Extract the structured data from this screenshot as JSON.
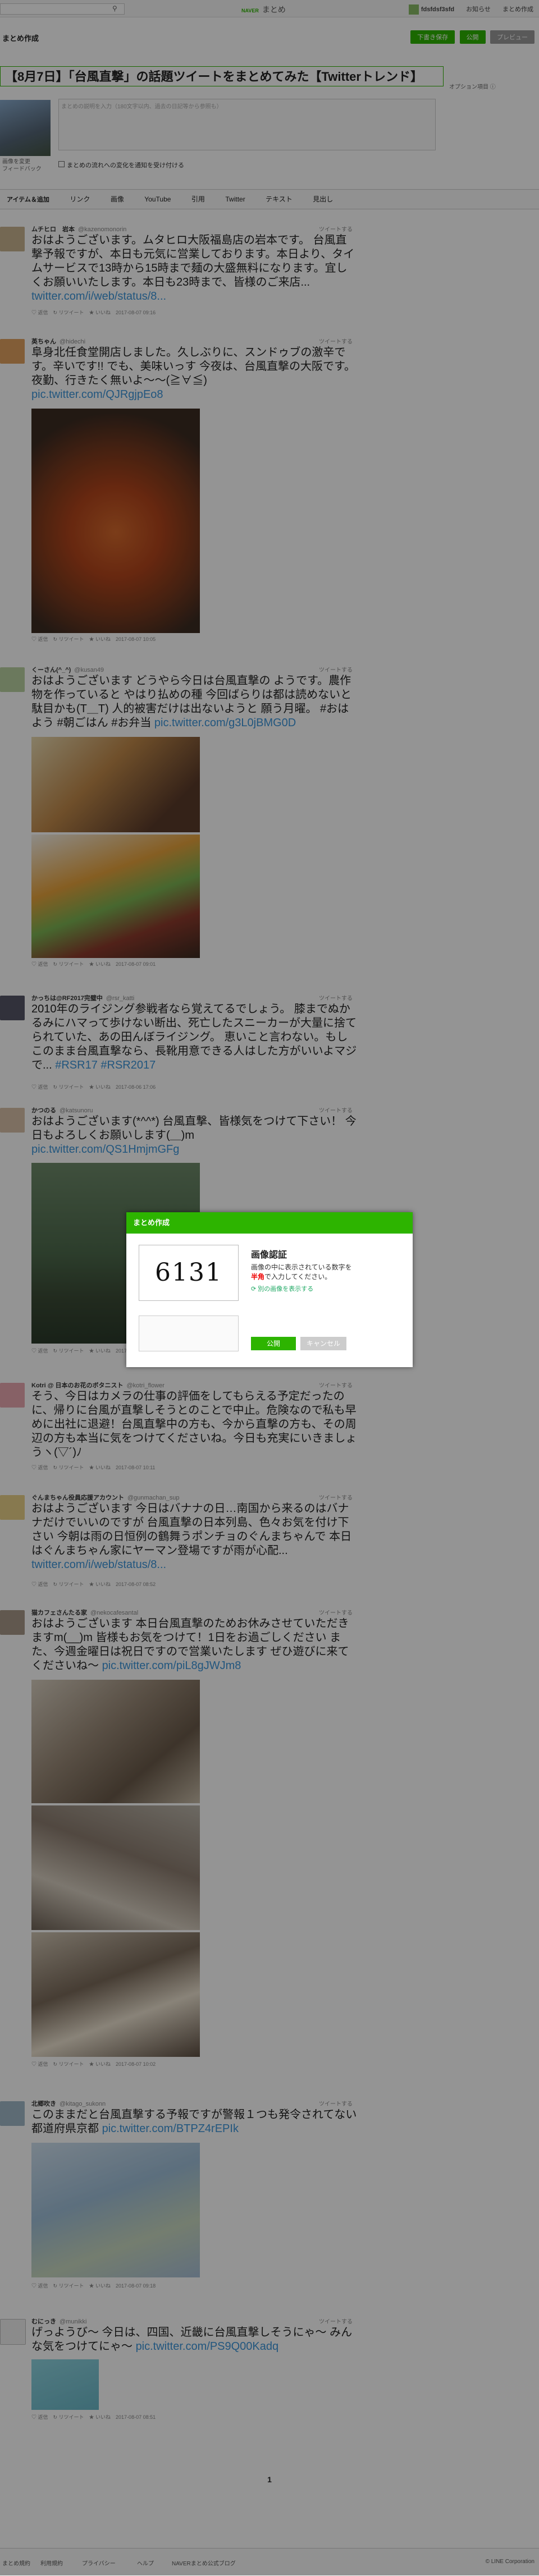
{
  "brand": {
    "naver": "NAVER",
    "name": "まとめ"
  },
  "user": {
    "name": "fdsfdsf3sfd"
  },
  "userlinks": {
    "notice": "お知らせ",
    "my": "まとめ作成"
  },
  "editor": {
    "heading": "まとめ作成",
    "save_draft": "下書き保存",
    "publish": "公開",
    "preview": "プレビュー"
  },
  "title": "【8月7日】「台風直撃」の話題ツイートをまとめてみた【Twitterトレンド】",
  "option_link": "オプション項目 ⓘ",
  "thumb_label": "画像を変更",
  "thumb_link": "フィードバック",
  "description_placeholder": "まとめの説明を入力（180文字以内、過去の日記等から参照も）",
  "notify_label": "まとめの流れへの変化を通知を受け付ける",
  "tabs": [
    "アイテム＆追加",
    "リンク",
    "画像",
    "YouTube",
    "引用",
    "Twitter",
    "テキスト",
    "見出し"
  ],
  "items": [
    {
      "name": "ムチヒロ　岩本",
      "uid": "@kazenomonorin",
      "rt": "ツイートする",
      "text": "おはようございます。ムタヒロ大阪福島店の岩本です。 台風直撃予報ですが、本日も元気に営業しております。本日より、タイムサービスで13時から15時まで麺の大盛無料になります。宜しくお願いいたします。本日も23時まで、皆様のご来店...",
      "link": "twitter.com/i/web/status/8...",
      "meta": "♡ 返信　↻ リツイート　★ いいね　2017-08-07 09:16"
    },
    {
      "name": "英ちゃん",
      "uid": "@hidechi",
      "rt": "ツイートする",
      "text": "阜身北任食堂開店しました。久しぶりに、スンドゥブの激辛です。辛いです!! でも、美味いっす 今夜は、台風直撃の大阪です。 夜勤、行きたく無いよ〜〜(≧∀≦)",
      "link": "pic.twitter.com/QJRgjpEo8",
      "meta": "♡ 返信　↻ リツイート　★ いいね　2017-08-07 10:05"
    },
    {
      "name": "くーさん(^_^)",
      "uid": "@kusan49",
      "rt": "ツイートする",
      "text": "おはようございます どうやら今日は台風直撃の ようです。農作物を作っていると やはり払めの種 今回ばらりは都は読めないと 駄目かも(T＿T) 人的被害だけは出ないようと 願う月曜。 #おはよう #朝ごはん #お弁当",
      "link": "pic.twitter.com/g3L0jBMG0D",
      "meta": "♡ 返信　↻ リツイート　★ いいね　2017-08-07 09:01"
    },
    {
      "name": "かっちは@RF2017完璧中",
      "uid": "@rsr_katti",
      "rt": "ツイートする",
      "text": "2010年のライジング参戦者なら覚えてるでしょう。 膝までぬかるみにハマって歩けない断出、死亡したスニーカーが大量に捨てられていた、あの田んぼライジング。 恵いこと言わない。もしこのまま台風直撃なら、長靴用意できる人はした方がいいよマジで...",
      "link": "#RSR17 #RSR2017",
      "meta": "♡ 返信　↻ リツイート　★ いいね　2017-08-06 17:06"
    },
    {
      "name": "かつのる",
      "uid": "@katsunoru",
      "rt": "ツイートする",
      "text": "おはようございます(*^^*) 台風直撃、皆様気をつけて下さい！ 今日もよろしくお願いします(＿)m",
      "link": "pic.twitter.com/QS1HmjmGFg",
      "meta": "♡ 返信　↻ リツイート　★ いいね　2017-08-07 08:47"
    },
    {
      "name": "Kotri @ 日本のお花のボタニスト",
      "uid": "@kotri_flower",
      "rt": "ツイートする",
      "text": "そう、今日はカメラの仕事の評価をしてもらえる予定だったのに、帰りに台風が直撃しそうとのことで中止。危険なので私も早めに出社に退避！台風直撃中の方も、今から直撃の方も、その周辺の方も本当に気をつけてくださいね。今日も充実にいきましょうヽ(▽´)ﾉ",
      "link": "",
      "meta": "♡ 返信　↻ リツイート　★ いいね　2017-08-07 10:11"
    },
    {
      "name": "ぐんまちゃん役員応援アカウント",
      "uid": "@gunmachan_sup",
      "rt": "ツイートする",
      "text": "おはようございます 今日はバナナの日…南国から来るのはバナナだけでいいのですが 台風直撃の日本列島、色々お気を付け下さい 今朝は雨の日恒例の鶴舞うポンチョのぐんまちゃんで 本日はぐんまちゃん家にヤーマン登場ですが雨が心配...",
      "link": "twitter.com/i/web/status/8...",
      "meta": "♡ 返信　↻ リツイート　★ いいね　2017-08-07 08:52"
    },
    {
      "name": "猫カフェさんたる家",
      "uid": "@nekocafesantal",
      "rt": "ツイートする",
      "text": "おはようございます 本日台風直撃のためお休みさせていただきますm(__)m 皆様もお気をつけて！1日をお過ごしください また、今週金曜日は祝日ですので営業いたします ぜひ遊びに来てくださいね〜",
      "link": "pic.twitter.com/piL8gJWJm8",
      "meta": "♡ 返信　↻ リツイート　★ いいね　2017-08-07 10:02"
    },
    {
      "name": "北郷吹き",
      "uid": "@kitago_sukonn",
      "rt": "ツイートする",
      "text": "このままだと台風直撃する予報ですが警報１つも発令されてない都道府県京都",
      "link": "pic.twitter.com/BTPZ4rEPIk",
      "meta": "♡ 返信　↻ リツイート　★ いいね　2017-08-07 09:18"
    },
    {
      "name": "むにっき",
      "uid": "@munikki",
      "rt": "ツイートする",
      "text": "げっようび〜 今日は、四国、近畿に台風直撃しそうにゃ〜 みんな気をつけてにゃ〜",
      "link": "pic.twitter.com/PS9Q00Kadq",
      "meta": "♡ 返信　↻ リツイート　★ いいね　2017-08-07 08:51"
    }
  ],
  "pagination": {
    "current": "1"
  },
  "footer": {
    "links": [
      "まとめ規約",
      "利用規約",
      "プライバシー",
      "ヘルプ",
      "NAVERまとめ公式ブログ"
    ],
    "copyright": "© LINE Corporation"
  },
  "modal": {
    "header": "まとめ作成",
    "captcha_text": "6131",
    "title": "画像認証",
    "info_prefix": "画像の中に表示されている数字を",
    "info_em": "半角",
    "info_suffix": "で入力してください。",
    "refresh": "別の画像を表示する",
    "ok": "公開",
    "cancel": "キャンセル"
  }
}
